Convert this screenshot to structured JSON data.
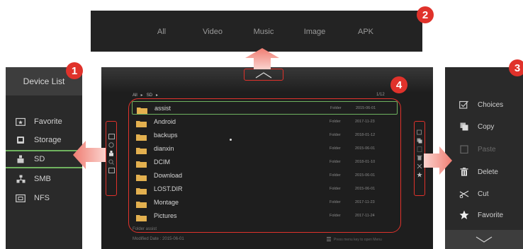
{
  "badges": {
    "left": "1",
    "top": "2",
    "right": "3",
    "main": "4"
  },
  "tabs": [
    {
      "label": "All",
      "active": true
    },
    {
      "label": "Video",
      "active": false
    },
    {
      "label": "Music",
      "active": false
    },
    {
      "label": "Image",
      "active": false
    },
    {
      "label": "APK",
      "active": false
    }
  ],
  "device_list": {
    "title": "Device List",
    "items": [
      {
        "label": "Favorite",
        "icon": "favorite-folder-icon"
      },
      {
        "label": "Storage",
        "icon": "storage-icon"
      },
      {
        "label": "SD",
        "icon": "sd-card-icon",
        "selected": true
      },
      {
        "label": "SMB",
        "icon": "network-icon"
      },
      {
        "label": "NFS",
        "icon": "nfs-folder-icon"
      }
    ]
  },
  "menu": {
    "items": [
      {
        "label": "Choices",
        "icon": "checkbox-icon",
        "enabled": true
      },
      {
        "label": "Copy",
        "icon": "copy-icon",
        "enabled": true
      },
      {
        "label": "Paste",
        "icon": "paste-icon",
        "enabled": false
      },
      {
        "label": "Delete",
        "icon": "trash-icon",
        "enabled": true
      },
      {
        "label": "Cut",
        "icon": "scissors-icon",
        "enabled": true
      },
      {
        "label": "Favorite",
        "icon": "star-icon",
        "enabled": true
      }
    ]
  },
  "browser": {
    "path_root": "All",
    "path_sep": "▸",
    "path_item": "SD",
    "page": "1/12",
    "files": [
      {
        "name": "assist",
        "type": "Folder",
        "date": "2015-06-01",
        "selected": true
      },
      {
        "name": "Android",
        "type": "Folder",
        "date": "2017-11-23"
      },
      {
        "name": "backups",
        "type": "Folder",
        "date": "2018-01-12"
      },
      {
        "name": "dianxin",
        "type": "Folder",
        "date": "2015-06-01"
      },
      {
        "name": "DCIM",
        "type": "Folder",
        "date": "2018-01-10"
      },
      {
        "name": "Download",
        "type": "Folder",
        "date": "2015-06-01"
      },
      {
        "name": "LOST.DIR",
        "type": "Folder",
        "date": "2015-06-01"
      },
      {
        "name": "Montage",
        "type": "Folder",
        "date": "2017-11-23"
      },
      {
        "name": "Pictures",
        "type": "Folder",
        "date": "2017-11-24"
      }
    ],
    "info_type": "Folder   assist",
    "info_date": "Modified Date : 2015-06-01",
    "hint": "Press menu key to open Menu"
  },
  "colors": {
    "accent_green": "#6fb25f",
    "highlight_red": "#e0322b",
    "arrow_pink": "#f08a80",
    "folder": "#e3b04f"
  }
}
